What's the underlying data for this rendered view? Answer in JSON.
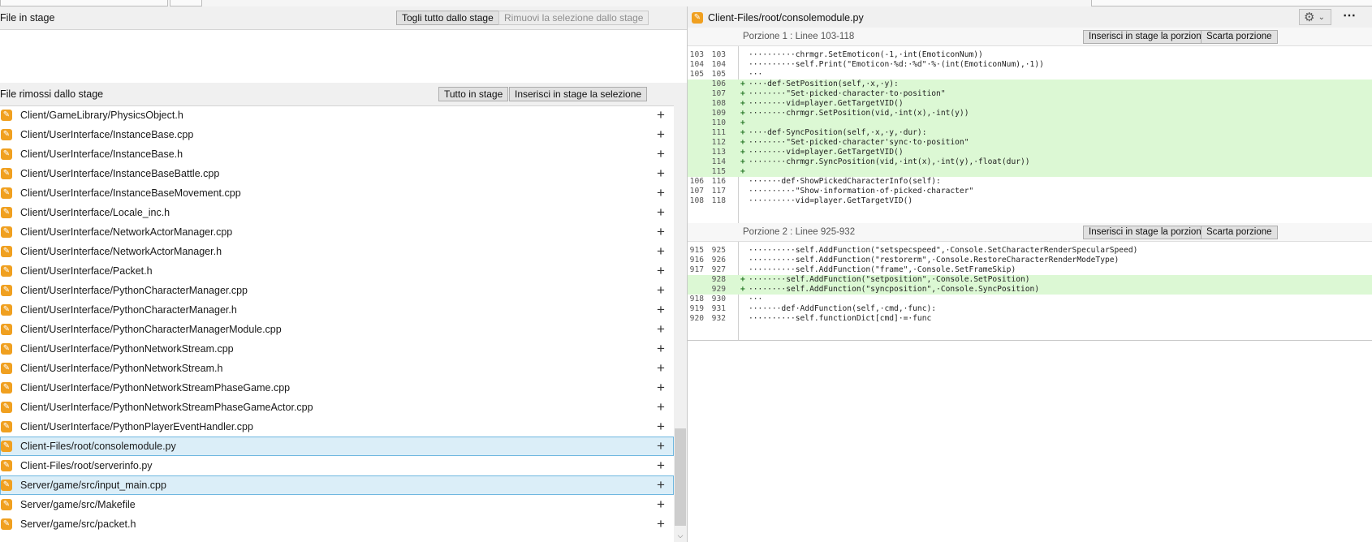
{
  "staged": {
    "title": "File in stage",
    "unstage_all": "Togli tutto dallo stage",
    "unstage_selection": "Rimuovi la selezione dallo stage"
  },
  "unstaged": {
    "title": "File rimossi dallo stage",
    "stage_all": "Tutto in stage",
    "stage_selection": "Inserisci in stage la selezione",
    "files": [
      {
        "name": "Client/GameLibrary/PhysicsObject.h",
        "selected": false
      },
      {
        "name": "Client/UserInterface/InstanceBase.cpp",
        "selected": false
      },
      {
        "name": "Client/UserInterface/InstanceBase.h",
        "selected": false
      },
      {
        "name": "Client/UserInterface/InstanceBaseBattle.cpp",
        "selected": false
      },
      {
        "name": "Client/UserInterface/InstanceBaseMovement.cpp",
        "selected": false
      },
      {
        "name": "Client/UserInterface/Locale_inc.h",
        "selected": false
      },
      {
        "name": "Client/UserInterface/NetworkActorManager.cpp",
        "selected": false
      },
      {
        "name": "Client/UserInterface/NetworkActorManager.h",
        "selected": false
      },
      {
        "name": "Client/UserInterface/Packet.h",
        "selected": false
      },
      {
        "name": "Client/UserInterface/PythonCharacterManager.cpp",
        "selected": false
      },
      {
        "name": "Client/UserInterface/PythonCharacterManager.h",
        "selected": false
      },
      {
        "name": "Client/UserInterface/PythonCharacterManagerModule.cpp",
        "selected": false
      },
      {
        "name": "Client/UserInterface/PythonNetworkStream.cpp",
        "selected": false
      },
      {
        "name": "Client/UserInterface/PythonNetworkStream.h",
        "selected": false
      },
      {
        "name": "Client/UserInterface/PythonNetworkStreamPhaseGame.cpp",
        "selected": false
      },
      {
        "name": "Client/UserInterface/PythonNetworkStreamPhaseGameActor.cpp",
        "selected": false
      },
      {
        "name": "Client/UserInterface/PythonPlayerEventHandler.cpp",
        "selected": false
      },
      {
        "name": "Client-Files/root/consolemodule.py",
        "selected": true
      },
      {
        "name": "Client-Files/root/serverinfo.py",
        "selected": false
      },
      {
        "name": "Server/game/src/input_main.cpp",
        "selected": true
      },
      {
        "name": "Server/game/src/Makefile",
        "selected": false
      },
      {
        "name": "Server/game/src/packet.h",
        "selected": false
      }
    ]
  },
  "diff": {
    "file": "Client-Files/root/consolemodule.py",
    "icons": {
      "file": "pencil-icon",
      "settings": "gear-icon",
      "more": "more-icon",
      "stage": "plus-icon"
    },
    "colors": {
      "added_bg": "#dcf8d4",
      "selected_row": "#dbeef8",
      "file_icon": "#f0a020"
    },
    "hunks": [
      {
        "title": "Porzione 1 : Linee 103-118",
        "stage_label": "Inserisci in stage la porzione",
        "discard_label": "Scarta porzione",
        "lines": [
          {
            "old": "103",
            "new": "103",
            "type": "ctx",
            "text": "··········chrmgr.SetEmoticon(-1,·int(EmoticonNum))"
          },
          {
            "old": "104",
            "new": "104",
            "type": "ctx",
            "text": "··········self.Print(\"Emoticon·%d:·%d\"·%·(int(EmoticonNum),·1))"
          },
          {
            "old": "105",
            "new": "105",
            "type": "ctx",
            "text": "···"
          },
          {
            "old": "",
            "new": "106",
            "type": "add",
            "text": "····def·SetPosition(self,·x,·y):"
          },
          {
            "old": "",
            "new": "107",
            "type": "add",
            "text": "········\"Set·picked·character·to·position\""
          },
          {
            "old": "",
            "new": "108",
            "type": "add",
            "text": "········vid=player.GetTargetVID()"
          },
          {
            "old": "",
            "new": "109",
            "type": "add",
            "text": "········chrmgr.SetPosition(vid,·int(x),·int(y))"
          },
          {
            "old": "",
            "new": "110",
            "type": "add",
            "text": ""
          },
          {
            "old": "",
            "new": "111",
            "type": "add",
            "text": "····def·SyncPosition(self,·x,·y,·dur):"
          },
          {
            "old": "",
            "new": "112",
            "type": "add",
            "text": "········\"Set·picked·character'sync·to·position\""
          },
          {
            "old": "",
            "new": "113",
            "type": "add",
            "text": "········vid=player.GetTargetVID()"
          },
          {
            "old": "",
            "new": "114",
            "type": "add",
            "text": "········chrmgr.SyncPosition(vid,·int(x),·int(y),·float(dur))"
          },
          {
            "old": "",
            "new": "115",
            "type": "add",
            "text": ""
          },
          {
            "old": "106",
            "new": "116",
            "type": "ctx",
            "text": "·······def·ShowPickedCharacterInfo(self):"
          },
          {
            "old": "107",
            "new": "117",
            "type": "ctx",
            "text": "··········\"Show·information·of·picked·character\""
          },
          {
            "old": "108",
            "new": "118",
            "type": "ctx",
            "text": "··········vid=player.GetTargetVID()"
          }
        ]
      },
      {
        "title": "Porzione 2 : Linee 925-932",
        "stage_label": "Inserisci in stage la porzione",
        "discard_label": "Scarta porzione",
        "lines": [
          {
            "old": "915",
            "new": "925",
            "type": "ctx",
            "text": "··········self.AddFunction(\"setspecspeed\",·Console.SetCharacterRenderSpecularSpeed)"
          },
          {
            "old": "916",
            "new": "926",
            "type": "ctx",
            "text": "··········self.AddFunction(\"restorerm\",·Console.RestoreCharacterRenderModeType)"
          },
          {
            "old": "917",
            "new": "927",
            "type": "ctx",
            "text": "··········self.AddFunction(\"frame\",·Console.SetFrameSkip)"
          },
          {
            "old": "",
            "new": "928",
            "type": "add",
            "text": "········self.AddFunction(\"setposition\",·Console.SetPosition)"
          },
          {
            "old": "",
            "new": "929",
            "type": "add",
            "text": "········self.AddFunction(\"syncposition\",·Console.SyncPosition)"
          },
          {
            "old": "918",
            "new": "930",
            "type": "ctx",
            "text": "···"
          },
          {
            "old": "919",
            "new": "931",
            "type": "ctx",
            "text": "·······def·AddFunction(self,·cmd,·func):"
          },
          {
            "old": "920",
            "new": "932",
            "type": "ctx",
            "text": "··········self.functionDict[cmd]·=·func"
          }
        ]
      }
    ]
  }
}
